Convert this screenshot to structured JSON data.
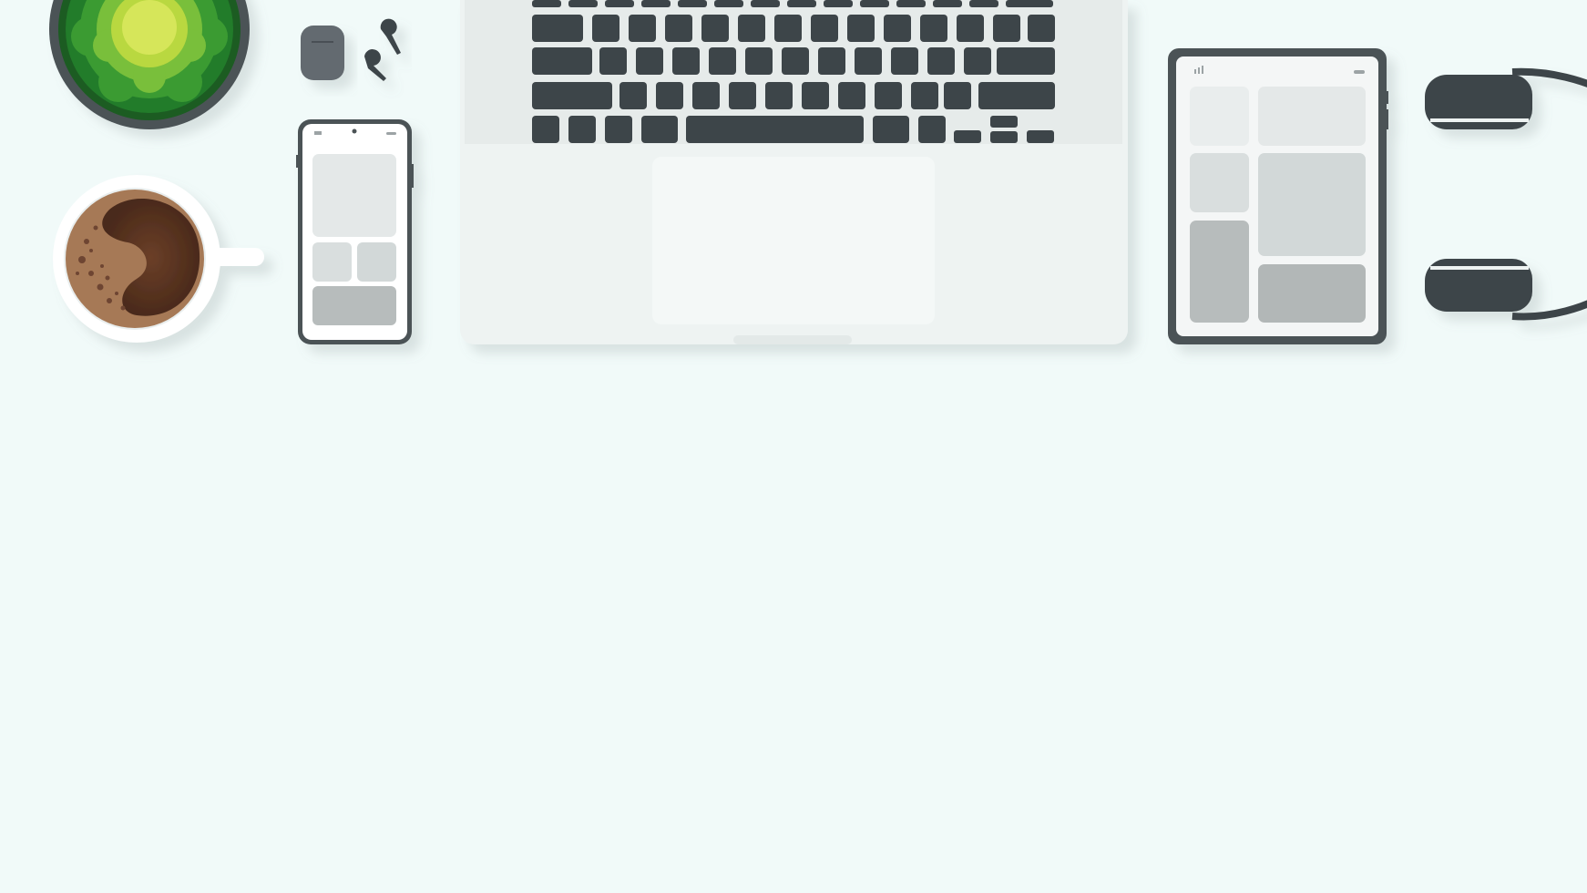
{
  "scene": {
    "background": "#f1faf9",
    "objects": [
      {
        "kind": "plant",
        "icon": "plant-icon"
      },
      {
        "kind": "earbuds-case",
        "icon": "earbuds-case-icon"
      },
      {
        "kind": "earbuds",
        "icon": "earbud-icon"
      },
      {
        "kind": "coffee-cup",
        "icon": "coffee-cup-icon"
      },
      {
        "kind": "smartphone",
        "icon": "smartphone-icon"
      },
      {
        "kind": "laptop",
        "icon": "laptop-icon"
      },
      {
        "kind": "tablet",
        "icon": "tablet-icon"
      },
      {
        "kind": "headphones",
        "icon": "headphones-icon"
      }
    ]
  },
  "colors": {
    "device_dark": "#4c5357",
    "key_dark": "#3e4448",
    "laptop_body": "#eef3f2",
    "screen_bg": "#f4f6f6",
    "tile_light": "#e4e8e8",
    "tile_mid": "#d2d8d8",
    "tile_dark": "#b7bcbc",
    "plant_green_dark": "#1f7a2a",
    "plant_green_light": "#cfe04c",
    "coffee_dark": "#5a3523",
    "coffee_light": "#a67957"
  }
}
